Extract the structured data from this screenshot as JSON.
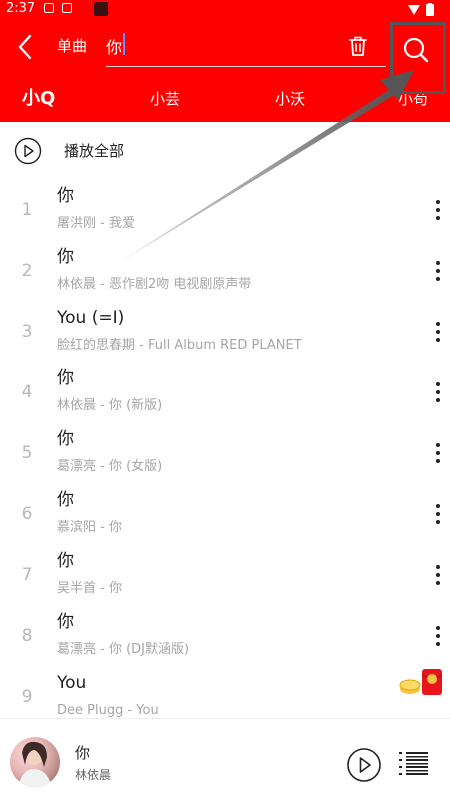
{
  "status_bar": {
    "time": "2:37"
  },
  "header": {
    "type_label": "单曲",
    "search_value": "你",
    "search_placeholder": ""
  },
  "tabs": [
    {
      "label": "小Q",
      "active": true
    },
    {
      "label": "小芸",
      "active": false
    },
    {
      "label": "小沃",
      "active": false
    },
    {
      "label": "小苟",
      "active": false
    }
  ],
  "play_all": {
    "label": "播放全部"
  },
  "songs": [
    {
      "index": "1",
      "title": "你",
      "subtitle": "屠洪刚 - 我爱"
    },
    {
      "index": "2",
      "title": "你",
      "subtitle": "林依晨 - 恶作剧2吻 电视剧原声带"
    },
    {
      "index": "3",
      "title": "You (=I)",
      "subtitle": "脸红的思春期 - Full Album RED PLANET"
    },
    {
      "index": "4",
      "title": "你",
      "subtitle": "林依晨 - 你 (新版)"
    },
    {
      "index": "5",
      "title": "你",
      "subtitle": "葛漂亮 - 你 (女版)"
    },
    {
      "index": "6",
      "title": "你",
      "subtitle": "慕滨阳 - 你"
    },
    {
      "index": "7",
      "title": "你",
      "subtitle": "吴半首 - 你"
    },
    {
      "index": "8",
      "title": "你",
      "subtitle": "葛漂亮 - 你 (DJ默涵版)"
    },
    {
      "index": "9",
      "title": "You",
      "subtitle": "Dee Plugg - You"
    }
  ],
  "mini_player": {
    "title": "你",
    "artist": "林依晨"
  },
  "colors": {
    "brand": "#ff0000",
    "index_gray": "#b8b8b8",
    "subtitle_gray": "#a6a6a6"
  }
}
